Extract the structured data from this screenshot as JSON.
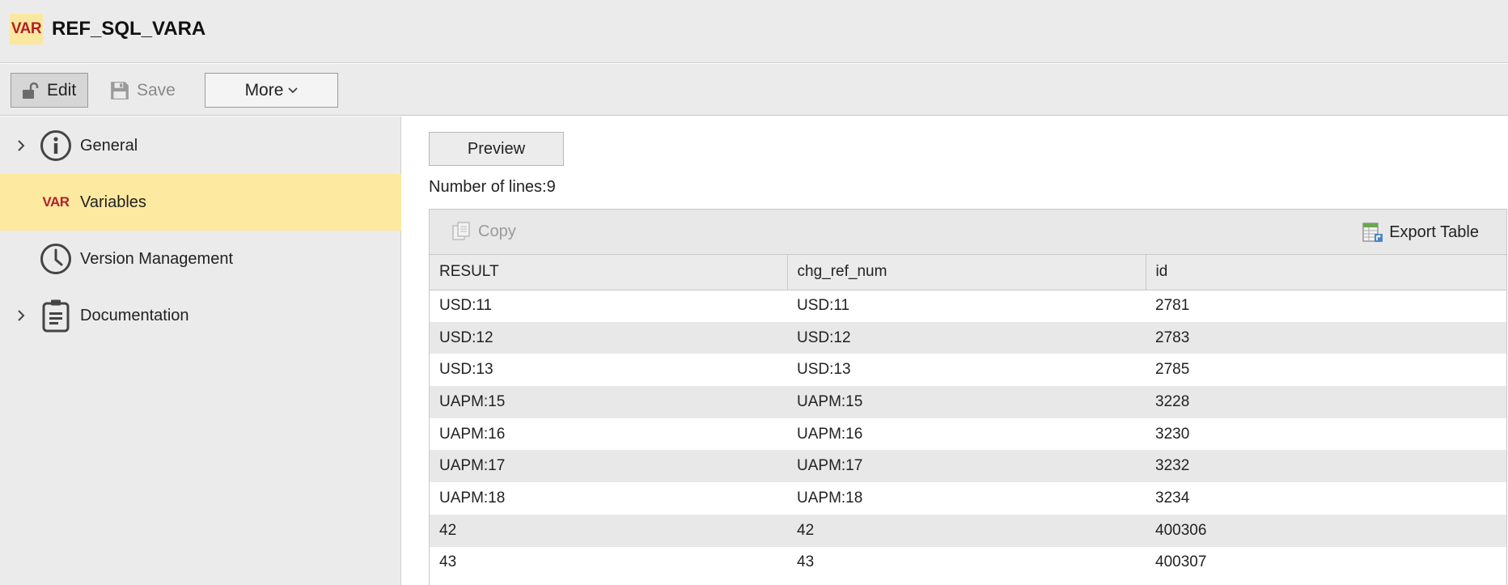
{
  "header": {
    "logo_text": "VAR",
    "title": "REF_SQL_VARA"
  },
  "toolbar": {
    "edit_label": "Edit",
    "save_label": "Save",
    "more_label": "More"
  },
  "sidebar": {
    "items": [
      {
        "label": "General",
        "icon": "info-icon",
        "expandable": true
      },
      {
        "label": "Variables",
        "icon": "var-icon",
        "icon_text": "VAR",
        "active": true
      },
      {
        "label": "Version Management",
        "icon": "clock-icon"
      },
      {
        "label": "Documentation",
        "icon": "clipboard-icon",
        "expandable": true
      }
    ]
  },
  "main": {
    "preview_label": "Preview",
    "lines_text": "Number of lines:9",
    "table_toolbar": {
      "copy_label": "Copy",
      "export_label": "Export Table"
    },
    "columns": [
      "RESULT",
      "chg_ref_num",
      "id"
    ],
    "rows": [
      [
        "USD:11",
        "USD:11",
        "2781"
      ],
      [
        "USD:12",
        "USD:12",
        "2783"
      ],
      [
        "USD:13",
        "USD:13",
        "2785"
      ],
      [
        "UAPM:15",
        "UAPM:15",
        "3228"
      ],
      [
        "UAPM:16",
        "UAPM:16",
        "3230"
      ],
      [
        "UAPM:17",
        "UAPM:17",
        "3232"
      ],
      [
        "UAPM:18",
        "UAPM:18",
        "3234"
      ],
      [
        "42",
        "42",
        "400306"
      ],
      [
        "43",
        "43",
        "400307"
      ]
    ]
  },
  "colors": {
    "active_bg": "#fde99f",
    "var_red": "#b3202a",
    "toolbar_bg": "#ebebeb"
  }
}
